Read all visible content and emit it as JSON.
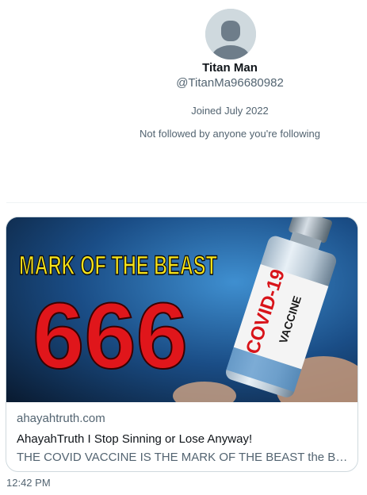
{
  "profile": {
    "name": "Titan Man",
    "handle": "@TitanMa96680982",
    "joined": "Joined July 2022",
    "followed_by": "Not followed by anyone you're following"
  },
  "link_card": {
    "image_text": {
      "headline": "MARK OF THE BEAST",
      "number": "666",
      "vial_label_main": "COVID-19",
      "vial_label_sub": "VACCINE"
    },
    "domain": "ahayahtruth.com",
    "title": "AhayahTruth I Stop Sinning or Lose Anyway!",
    "description": "THE COVID VACCINE IS THE MARK OF THE BEAST the Bible says..."
  },
  "message": {
    "time": "12:42 PM"
  },
  "colors": {
    "primary_text": "#0f1419",
    "secondary_text": "#536471",
    "border": "#cfd9de",
    "headline_yellow": "#f5e21a",
    "number_red": "#e0161b"
  }
}
